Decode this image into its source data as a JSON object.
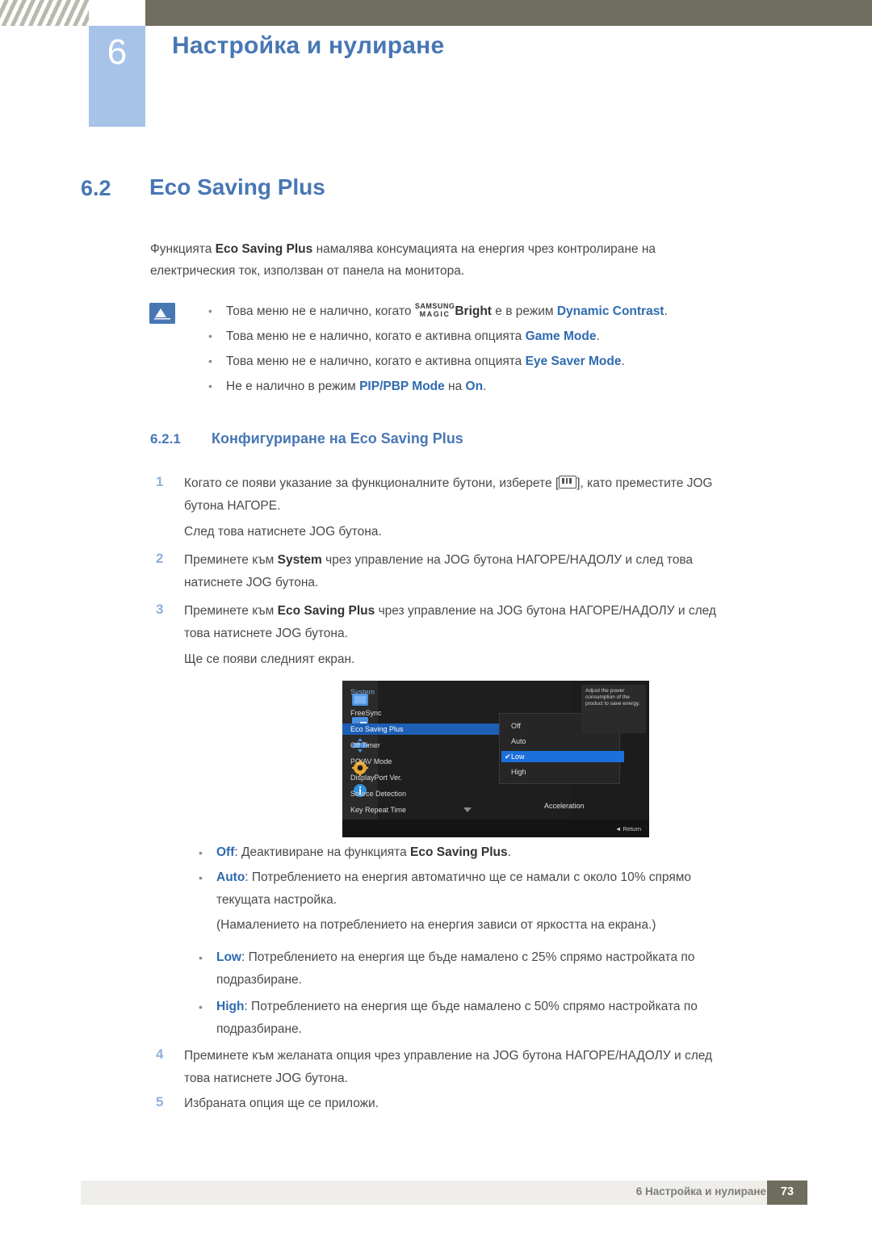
{
  "header": {
    "chapter_number": "6",
    "chapter_title": "Настройка и нулиране"
  },
  "section": {
    "number": "6.2",
    "title": "Eco Saving Plus"
  },
  "intro": {
    "line1_a": "Функцията ",
    "line1_b": "Eco Saving Plus",
    "line1_c": " намалява консумацията на енергия чрез контролиране на",
    "line2": "електрическия ток, използван от панела на монитора."
  },
  "notes": [
    {
      "pre": "Това меню не е налично, когато ",
      "magic_top": "SAMSUNG",
      "magic_bottom": "MAGIC",
      "bold1": "Bright",
      "mid": " е в режим ",
      "bold2": "Dynamic Contrast",
      "post": "."
    },
    {
      "pre": "Това меню не е налично, когато е активна опцията ",
      "bold1": "Game Mode",
      "post": "."
    },
    {
      "pre": "Това меню не е налично, когато е активна опцията ",
      "bold1": "Eye Saver Mode",
      "post": "."
    },
    {
      "pre": "Не е налично в режим ",
      "bold1": "PIP/PBP Mode",
      "mid": " на ",
      "bold2": "On",
      "post": "."
    }
  ],
  "subsection": {
    "number": "6.2.1",
    "title": "Конфигуриране на Eco Saving Plus"
  },
  "steps": {
    "s1_num": "1",
    "s1_a": "Когато се появи указание за функционалните бутони, изберете [",
    "s1_b": "], като преместите JOG",
    "s1_line2": "бутона НАГОРЕ.",
    "s1_after": "След това натиснете JOG бутона.",
    "s2_num": "2",
    "s2_a": "Преминете към ",
    "s2_bold": "System",
    "s2_b": " чрез управление на JOG бутона НАГОРЕ/НАДОЛУ и след това",
    "s2_line2": "натиснете JOG бутона.",
    "s3_num": "3",
    "s3_a": "Преминете към ",
    "s3_bold": "Eco Saving Plus",
    "s3_b": " чрез управление на JOG бутона НАГОРЕ/НАДОЛУ и след",
    "s3_line2": "това натиснете JOG бутона.",
    "s3_after": "Ще се появи следният екран.",
    "s4_num": "4",
    "s4_a": "Преминете към желаната опция чрез управление на JOG бутона НАГОРЕ/НАДОЛУ и след",
    "s4_line2": "това натиснете JOG бутона.",
    "s5_num": "5",
    "s5_a": "Избраната опция ще се приложи."
  },
  "osd": {
    "title": "System",
    "menu_items": [
      "FreeSync",
      "Eco Saving Plus",
      "Off Timer",
      "PC/AV Mode",
      "DisplayPort Ver.",
      "Source Detection",
      "Key Repeat Time"
    ],
    "selected_menu_index": 1,
    "sub_items": [
      "Off",
      "Auto",
      "Low",
      "High"
    ],
    "selected_sub_index": 2,
    "check_glyph": "✔",
    "help_text": "Adjust the power consumption of the product to save energy.",
    "acceleration_label": "Acceleration",
    "return_label": "Return",
    "return_glyph": "◄"
  },
  "options": [
    {
      "bold": "Off",
      "text_a": ": Деактивиране на функцията ",
      "bold2": "Eco Saving Plus",
      "text_b": "."
    },
    {
      "bold": "Auto",
      "text_a": ": Потреблението на енергия автоматично ще се намали с около 10% спрямо",
      "line2": "текущата настройка.",
      "line3": "(Намалението на потреблението на енергия зависи от яркостта на екрана.)"
    },
    {
      "bold": "Low",
      "text_a": ": Потреблението на енергия ще бъде намалено с 25% спрямо настройката по",
      "line2": "подразбиране."
    },
    {
      "bold": "High",
      "text_a": ": Потреблението на енергия ще бъде намалено с 50% спрямо настройката по",
      "line2": "подразбиране."
    }
  ],
  "footer": {
    "text": "6 Настройка и нулиране",
    "page": "73"
  },
  "colors": {
    "accent_blue": "#4877b4",
    "header_bar": "#6f6d5d",
    "num_box": "#a8c3e8"
  }
}
